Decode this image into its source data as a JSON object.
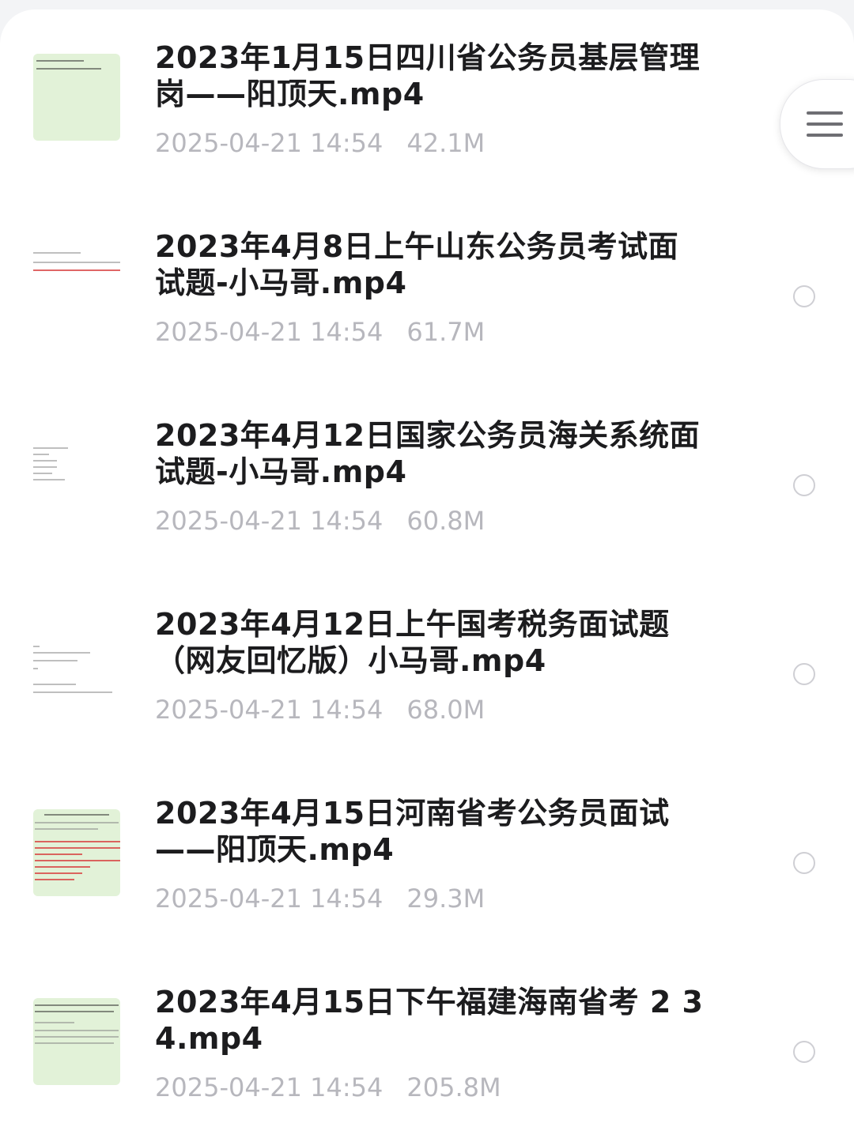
{
  "files": [
    {
      "title": "2023年1月15日四川省公务员基层管理岗——阳顶天.mp4",
      "date": "2025-04-21 14:54",
      "size": "42.1M"
    },
    {
      "title": "2023年4月8日上午山东公务员考试面试题-小马哥.mp4",
      "date": "2025-04-21 14:54",
      "size": "61.7M"
    },
    {
      "title": "2023年4月12日国家公务员海关系统面试题-小马哥.mp4",
      "date": "2025-04-21 14:54",
      "size": "60.8M"
    },
    {
      "title": "2023年4月12日上午国考税务面试题（网友回忆版）小马哥.mp4",
      "date": "2025-04-21 14:54",
      "size": "68.0M"
    },
    {
      "title": "2023年4月15日河南省考公务员面试——阳顶天.mp4",
      "date": "2025-04-21 14:54",
      "size": "29.3M"
    },
    {
      "title": "2023年4月15日下午福建海南省考 2 3 4.mp4",
      "date": "2025-04-21 14:54",
      "size": "205.8M"
    }
  ],
  "icons": {
    "menu": "menu-lines-icon",
    "select": "radio-circle-icon"
  },
  "colors": {
    "title": "#1c1c1e",
    "meta": "#b7b7bd",
    "thumb_green": "#e2f2d8"
  }
}
